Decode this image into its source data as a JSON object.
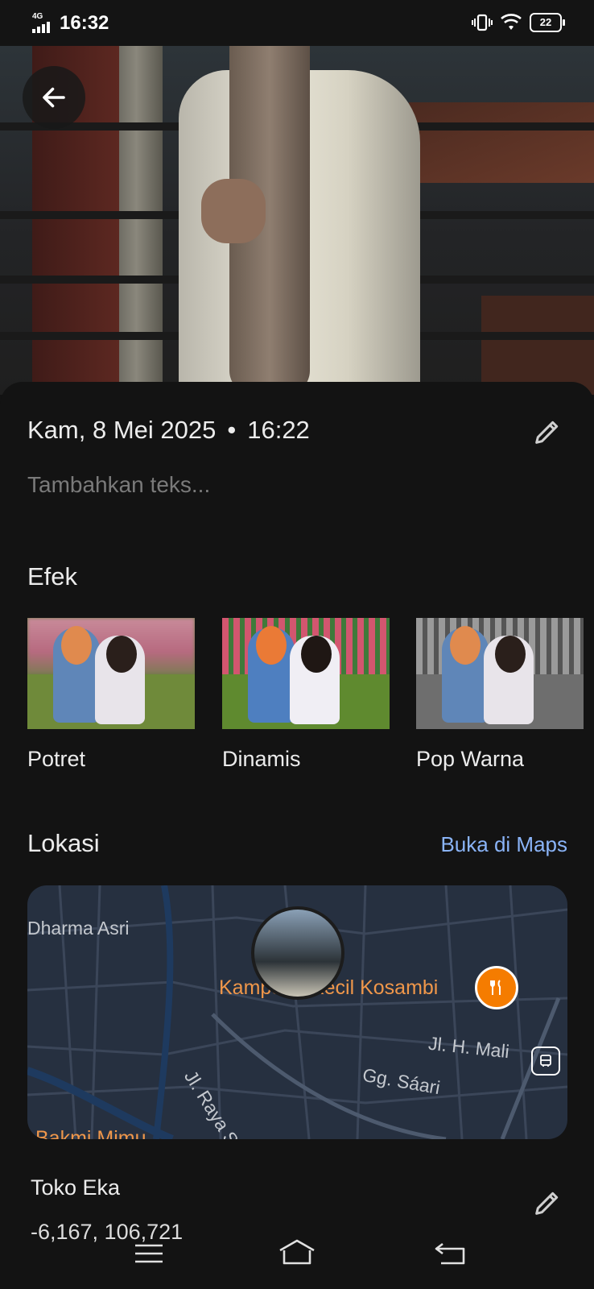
{
  "status_bar": {
    "network": "4G",
    "time": "16:32",
    "battery": "22"
  },
  "details": {
    "date": "Kam, 8 Mei 2025",
    "time": "16:22",
    "caption_placeholder": "Tambahkan teks..."
  },
  "effects": {
    "title": "Efek",
    "items": [
      {
        "label": "Potret"
      },
      {
        "label": "Dinamis"
      },
      {
        "label": "Pop Warna"
      }
    ]
  },
  "location": {
    "title": "Lokasi",
    "open_maps": "Buka di Maps",
    "map_labels": {
      "street1": "Dharma Asri",
      "poi": "Kampung Kecil Kosambi",
      "street2": "Jl. H. Mali",
      "street3": "Gg. Sáari",
      "street4": "Jl. Raya Swadana",
      "poi2": "Bakmi Mimu"
    },
    "place_name": "Toko Eka",
    "coordinates": "-6,167, 106,721"
  },
  "colors": {
    "background": "#131313",
    "link": "#8ab4f8",
    "poi": "#f0974a"
  }
}
